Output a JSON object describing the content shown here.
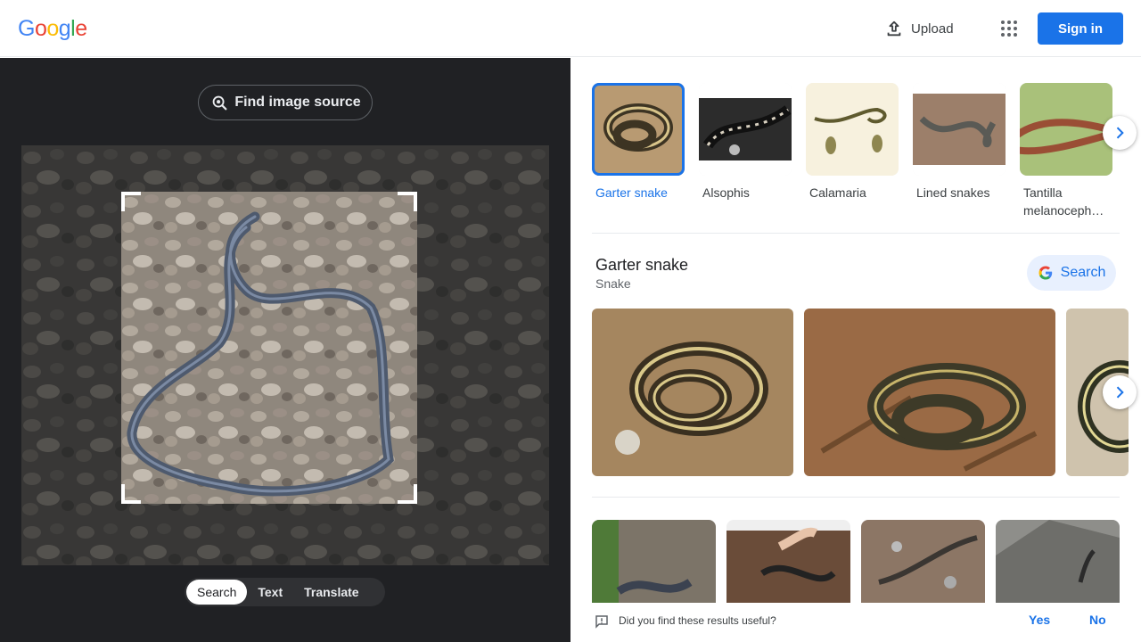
{
  "header": {
    "logo_letters": [
      "G",
      "o",
      "o",
      "g",
      "l",
      "e"
    ],
    "logo_colors": [
      "#4285f4",
      "#ea4335",
      "#fbbc05",
      "#4285f4",
      "#34a853",
      "#ea4335"
    ],
    "upload_label": "Upload",
    "upload_icon": "upload-icon",
    "apps_icon": "apps-grid-icon",
    "signin_label": "Sign in",
    "accent": "#1a73e8"
  },
  "left_panel": {
    "find_source_label": "Find image source",
    "find_source_icon": "lens-search-icon",
    "modes": [
      {
        "label": "Search",
        "active": true
      },
      {
        "label": "Text",
        "active": false
      },
      {
        "label": "Translate",
        "active": false
      }
    ]
  },
  "results": {
    "chips": [
      {
        "label": "Garter snake",
        "selected": true
      },
      {
        "label": "Alsophis",
        "selected": false
      },
      {
        "label": "Calamaria",
        "selected": false
      },
      {
        "label": "Lined snakes",
        "selected": false
      },
      {
        "label": "Tantilla melanoceph…",
        "selected": false
      }
    ],
    "entity": {
      "title": "Garter snake",
      "subtitle": "Snake",
      "search_label": "Search"
    },
    "feedback": {
      "question": "Did you find these results useful?",
      "yes": "Yes",
      "no": "No"
    }
  }
}
